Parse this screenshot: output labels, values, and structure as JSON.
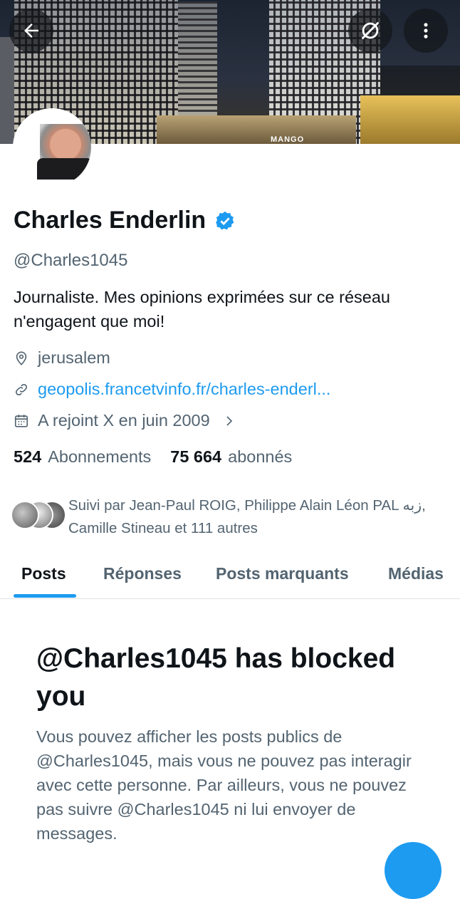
{
  "banner": {
    "shop_sign": "MANGO"
  },
  "profile": {
    "name": "Charles Enderlin",
    "handle": "@Charles1045",
    "bio": "Journaliste. Mes opinions exprimées sur ce réseau n'engagent que moi!",
    "location": "jerusalem",
    "website": "geopolis.francetvinfo.fr/charles-enderl...",
    "joined": "A rejoint X en juin 2009",
    "verified_color": "#1d9bf0"
  },
  "stats": {
    "following_count": "524",
    "following_label": "Abonnements",
    "followers_count": "75 664",
    "followers_label": "abonnés"
  },
  "followed_by": "Suivi par Jean-Paul ROIG, Philippe Alain Léon PAL زبه, Camille Stineau et 111 autres",
  "tabs": [
    "Posts",
    "Réponses",
    "Posts marquants",
    "Médias"
  ],
  "blocked": {
    "title": "@Charles1045 has blocked you",
    "body": "Vous pouvez afficher les posts publics de @Charles1045, mais vous ne pouvez pas interagir avec cette personne. Par ailleurs, vous ne pouvez pas suivre @Charles1045 ni lui envoyer de messages."
  },
  "colors": {
    "accent": "#1d9bf0",
    "text": "#0f1419",
    "muted": "#536471"
  }
}
